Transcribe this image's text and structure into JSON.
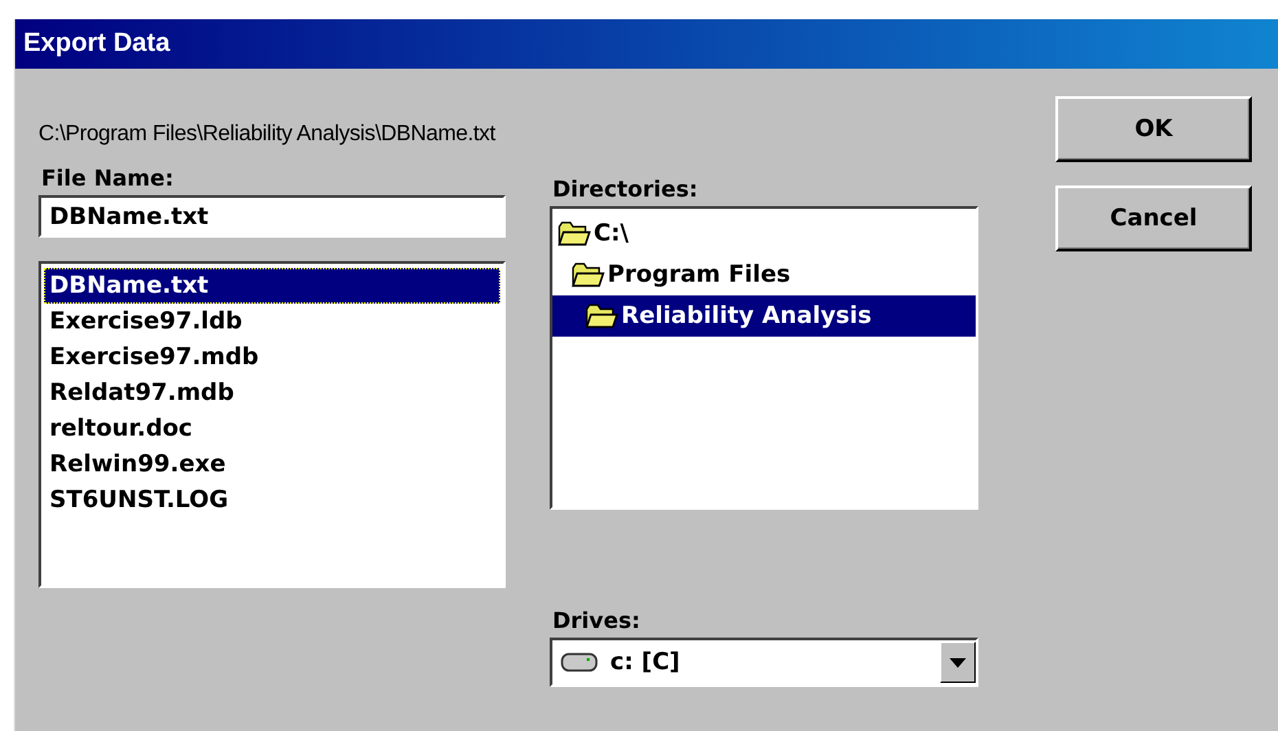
{
  "window": {
    "title": "Export Data"
  },
  "path": "C:\\Program Files\\Reliability Analysis\\DBName.txt",
  "file_name": {
    "label": "File Name:",
    "value": "DBName.txt"
  },
  "files": [
    {
      "name": "DBName.txt",
      "selected": true
    },
    {
      "name": "Exercise97.ldb",
      "selected": false
    },
    {
      "name": "Exercise97.mdb",
      "selected": false
    },
    {
      "name": "Reldat97.mdb",
      "selected": false
    },
    {
      "name": "reltour.doc",
      "selected": false
    },
    {
      "name": "Relwin99.exe",
      "selected": false
    },
    {
      "name": "ST6UNST.LOG",
      "selected": false
    }
  ],
  "directories": {
    "label": "Directories:",
    "items": [
      {
        "name": "C:\\",
        "selected": false,
        "children": [
          {
            "name": "Program Files",
            "selected": false,
            "children": [
              {
                "name": "Reliability Analysis",
                "selected": true
              }
            ]
          }
        ]
      }
    ]
  },
  "drives": {
    "label": "Drives:",
    "value": "c: [C]"
  },
  "buttons": [
    "OK",
    "Cancel"
  ]
}
